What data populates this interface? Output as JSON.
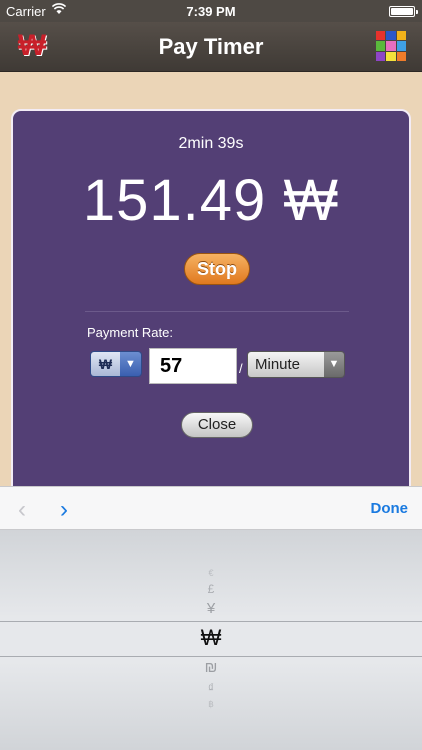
{
  "status_bar": {
    "carrier": "Carrier",
    "time": "7:39 PM"
  },
  "nav": {
    "title": "Pay Timer",
    "left_icon": "won-currency-icon",
    "left_symbol": "₩",
    "right_icon": "color-grid-icon",
    "grid_colors": [
      "#e8322c",
      "#2b56c8",
      "#f2b21a",
      "#5ab93c",
      "#e86ec0",
      "#3fa0e6",
      "#8e45c6",
      "#f4e23a",
      "#ef7c2a"
    ]
  },
  "timer": {
    "elapsed": "2min 39s",
    "amount": "151.49 ₩",
    "stop_label": "Stop"
  },
  "payment": {
    "label": "Payment Rate:",
    "currency": "₩",
    "rate_value": "57",
    "separator": "/",
    "unit": "Minute",
    "close_label": "Close"
  },
  "toolbar": {
    "prev_symbol": "‹",
    "next_symbol": "›",
    "done_label": "Done"
  },
  "picker": {
    "options": [
      "€",
      "£",
      "¥",
      "₩",
      "₪",
      "₫",
      "฿"
    ],
    "selected": "₩"
  },
  "colors": {
    "card_bg": "#533f75",
    "accent_blue": "#1a7ae0",
    "stop_orange": "#e8892b"
  }
}
